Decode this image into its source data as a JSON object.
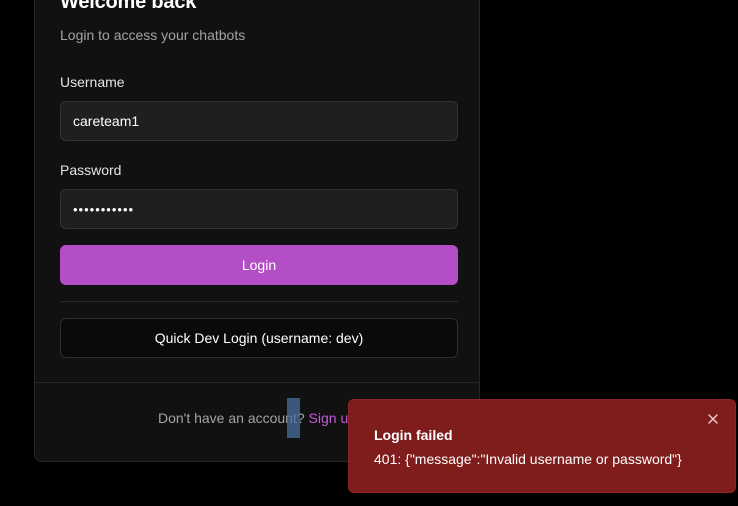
{
  "login_card": {
    "title": "Welcome back",
    "subtitle": "Login to access your chatbots",
    "username": {
      "label": "Username",
      "value": "careteam1"
    },
    "password": {
      "label": "Password",
      "value": "•••••••••••"
    },
    "login_button": "Login",
    "quick_dev_login_button": "Quick Dev Login (username: dev)",
    "footer": {
      "text": "Don't have an account? ",
      "link": "Sign up"
    }
  },
  "toast": {
    "title": "Login failed",
    "message": "401: {\"message\":\"Invalid username or password\"}",
    "close_icon": "close-icon"
  },
  "colors": {
    "primary": "#b44ec7",
    "toast_bg": "#7f1d1d",
    "link": "#c05bd6"
  }
}
